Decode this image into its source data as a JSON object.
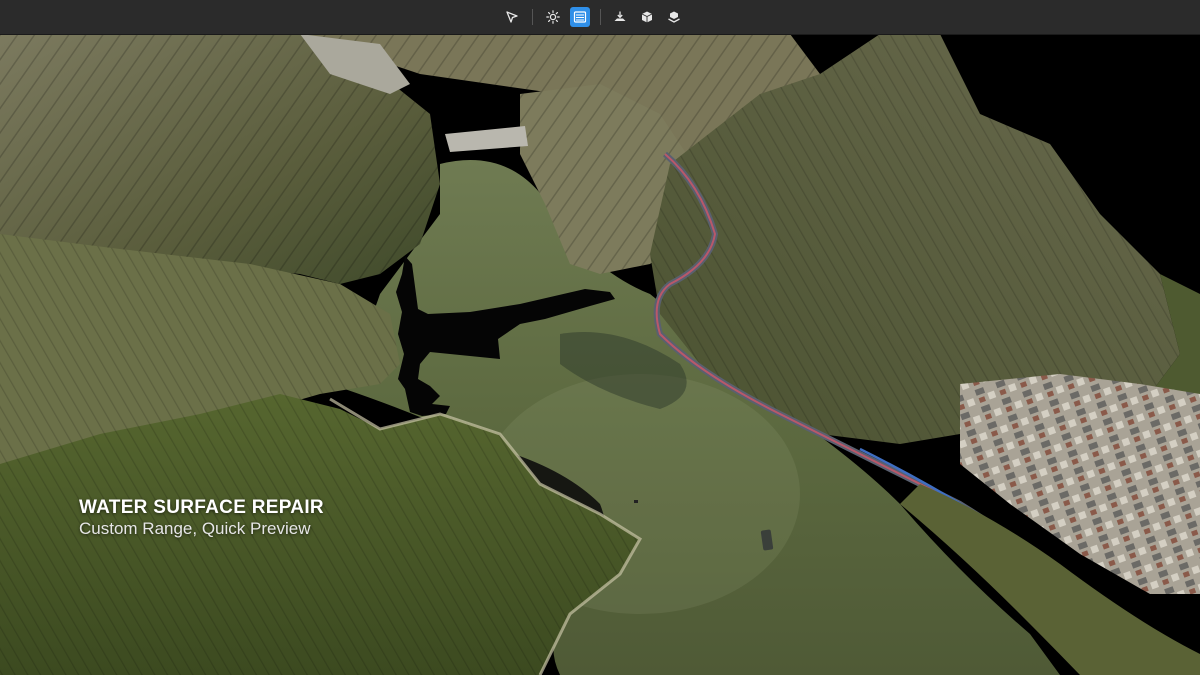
{
  "toolbar": {
    "tools": [
      {
        "id": "select",
        "icon": "cursor-arrow-icon",
        "active": false
      },
      {
        "id": "lighting",
        "icon": "sun-icon",
        "active": false
      },
      {
        "id": "water-surface",
        "icon": "water-surface-icon",
        "active": true
      },
      {
        "id": "flatten",
        "icon": "terrain-flatten-icon",
        "active": false
      },
      {
        "id": "model",
        "icon": "cube-icon",
        "active": false
      },
      {
        "id": "layer",
        "icon": "layer-model-icon",
        "active": false
      }
    ],
    "accent_color": "#2f8fe8"
  },
  "caption": {
    "title": "WATER SURFACE REPAIR",
    "subtitle": "Custom Range, Quick Preview"
  },
  "viewport": {
    "content": "3D aerial reconstruction of a reservoir valley with a black unrepaired water-surface hole"
  }
}
